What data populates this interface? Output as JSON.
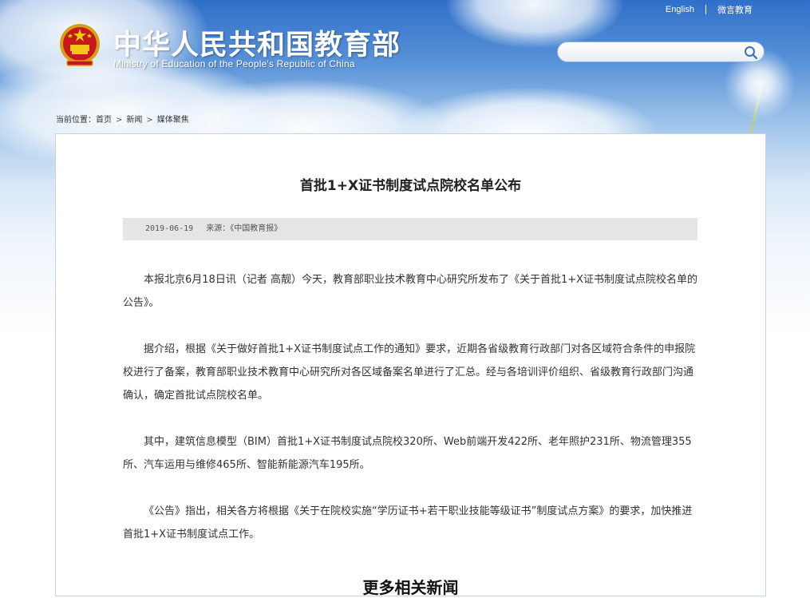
{
  "header": {
    "title_cn": "中华人民共和国教育部",
    "title_en": "Ministry of Education of the People's Republic of China",
    "links": {
      "english": "English",
      "weixin": "微言教育"
    },
    "search": {
      "placeholder": "",
      "value": ""
    }
  },
  "breadcrumb": {
    "prefix": "当前位置：",
    "items": [
      "首页",
      "新闻",
      "媒体聚焦"
    ]
  },
  "article": {
    "title": "首批1+X证书制度试点院校名单公布",
    "date": "2019-06-19",
    "source": "来源：《中国教育报》",
    "paragraphs": [
      "本报北京6月18日讯（记者 高靓）今天，教育部职业技术教育中心研究所发布了《关于首批1+X证书制度试点院校名单的公告》。",
      "据介绍，根据《关于做好首批1+X证书制度试点工作的通知》要求，近期各省级教育行政部门对各区域符合条件的申报院校进行了备案，教育部职业技术教育中心研究所对各区域备案名单进行了汇总。经与各培训评价组织、省级教育行政部门沟通确认，确定首批试点院校名单。",
      "其中，建筑信息模型（BIM）首批1+X证书制度试点院校320所、Web前端开发422所、老年照护231所、物流管理355所、汽车运用与维修465所、智能新能源汽车195所。",
      "《公告》指出，相关各方将根据《关于在院校实施“学历证书+若干职业技能等级证书”制度试点方案》的要求，加快推进首批1+X证书制度试点工作。"
    ],
    "next_heading": "更多相关新闻"
  }
}
